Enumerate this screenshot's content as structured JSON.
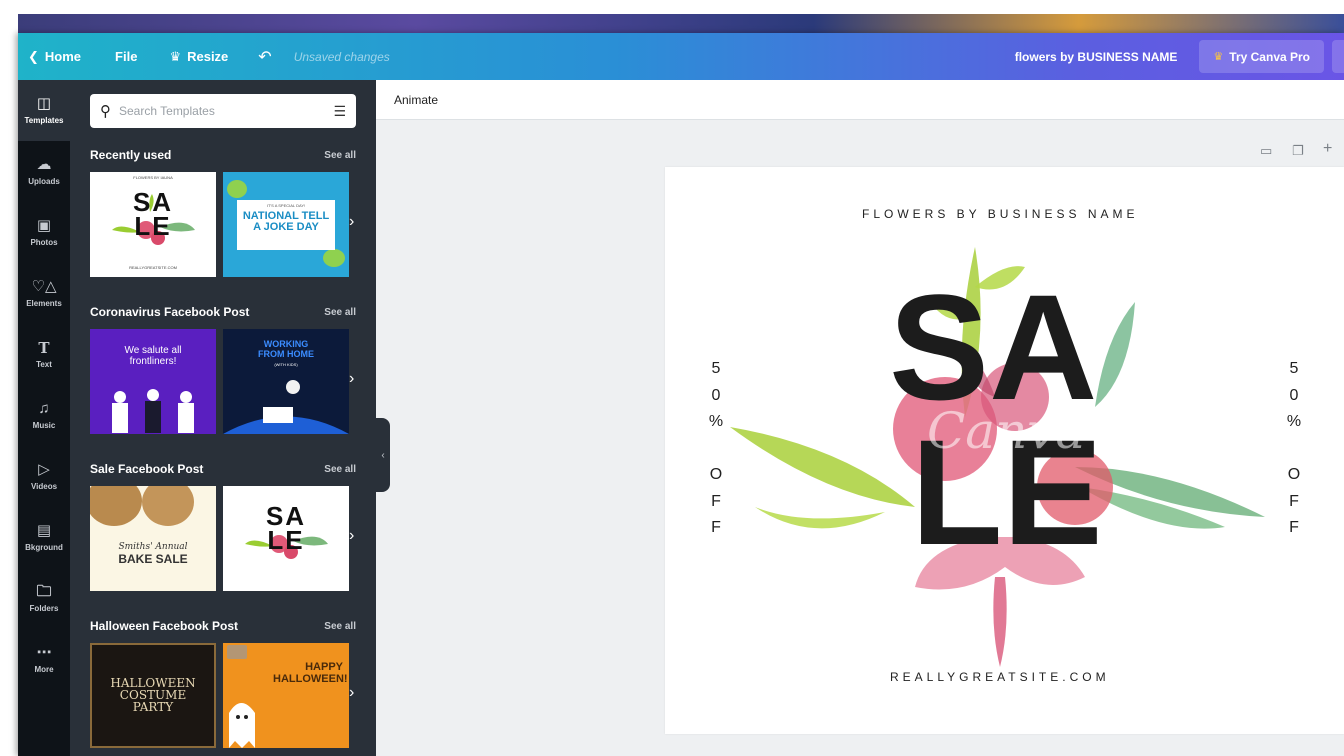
{
  "topbar": {
    "home_label": "Home",
    "file_label": "File",
    "resize_label": "Resize",
    "unsaved_label": "Unsaved changes",
    "doc_name": "flowers by BUSINESS NAME",
    "pro_label": "Try Canva Pro",
    "icons": {
      "back": "chevron-left-icon",
      "crown": "crown-icon",
      "undo": "undo-icon"
    }
  },
  "rail": {
    "items": [
      {
        "label": "Templates",
        "icon": "templates-icon"
      },
      {
        "label": "Uploads",
        "icon": "upload-cloud-icon"
      },
      {
        "label": "Photos",
        "icon": "image-icon"
      },
      {
        "label": "Elements",
        "icon": "shapes-icon"
      },
      {
        "label": "Text",
        "icon": "text-icon"
      },
      {
        "label": "Music",
        "icon": "music-note-icon"
      },
      {
        "label": "Videos",
        "icon": "video-icon"
      },
      {
        "label": "Bkground",
        "icon": "background-icon"
      },
      {
        "label": "Folders",
        "icon": "folder-icon"
      },
      {
        "label": "More",
        "icon": "more-dots-icon"
      }
    ]
  },
  "panel": {
    "search_placeholder": "Search Templates",
    "see_all": "See all",
    "sections": [
      {
        "title": "Recently used",
        "thumbs": [
          {
            "main": "SALE",
            "top": "FLOWERS BY IAUNA",
            "bottom": "REALLYGREATSITE.COM"
          },
          {
            "top": "IT'S A SPECIAL DAY!",
            "main": "NATIONAL TELL A JOKE DAY"
          }
        ]
      },
      {
        "title": "Coronavirus Facebook Post",
        "thumbs": [
          {
            "main": "We salute all frontliners!"
          },
          {
            "main": "WORKING FROM HOME",
            "sub": "(WITH KIDS)"
          }
        ]
      },
      {
        "title": "Sale Facebook Post",
        "thumbs": [
          {
            "script": "Smiths' Annual",
            "main": "BAKE SALE"
          },
          {
            "main": "SALE"
          }
        ]
      },
      {
        "title": "Halloween Facebook Post",
        "thumbs": [
          {
            "main": "HALLOWEEN COSTUME PARTY"
          },
          {
            "main": "HAPPY HALLOWEEN!"
          }
        ]
      }
    ]
  },
  "toolbar": {
    "animate_label": "Animate"
  },
  "design": {
    "top_text": "FLOWERS BY BUSINESS NAME",
    "sale_1": "SA",
    "sale_2": "LE",
    "side_chars": [
      "5",
      "0",
      "%",
      "",
      "O",
      "F",
      "F"
    ],
    "bottom_text": "REALLYGREATSITE.COM",
    "watermark": "Canva"
  },
  "colors": {
    "topbar_start": "#1fb3c9",
    "topbar_end": "#6a55e6",
    "rail_bg": "#0e1318",
    "panel_bg": "#293039",
    "canvas_bg": "#eef0f2"
  }
}
